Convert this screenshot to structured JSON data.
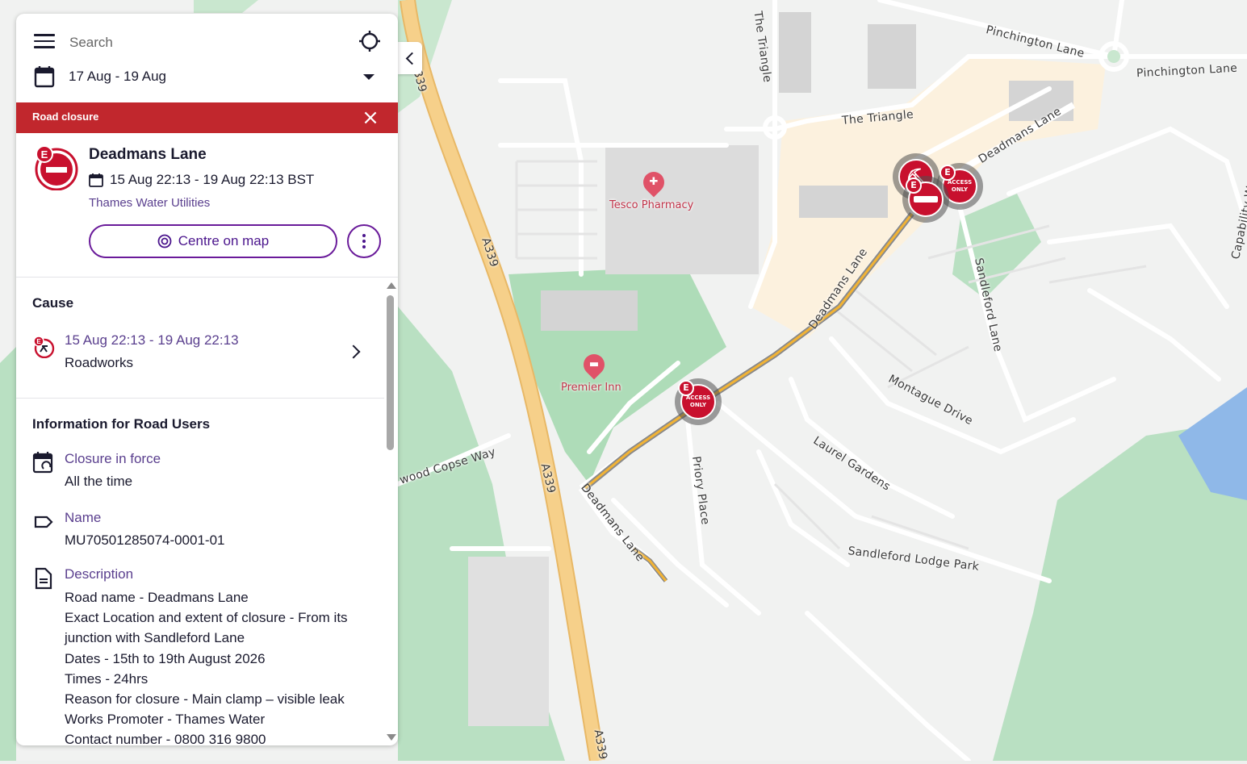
{
  "search": {
    "placeholder": "Search"
  },
  "date_filter": {
    "value": "17 Aug - 19 Aug"
  },
  "closure_bar": {
    "title": "Road closure"
  },
  "event": {
    "road_name": "Deadmans Lane",
    "period": "15 Aug 22:13 - 19 Aug 22:13 BST",
    "organisation": "Thames Water Utilities",
    "centre_button": "Centre on map"
  },
  "cause": {
    "title": "Cause",
    "date": "15 Aug 22:13 - 19 Aug 22:13",
    "type": "Roadworks"
  },
  "info": {
    "title": "Information for Road Users",
    "closure": {
      "label": "Closure in force",
      "value": "All the time"
    },
    "name": {
      "label": "Name",
      "value": "MU70501285074-0001-01"
    },
    "description": {
      "label": "Description",
      "lines": [
        "Road name - Deadmans Lane",
        "Exact Location and extent of closure - From its junction with Sandleford Lane",
        "Dates - 15th to 19th August 2026",
        "Times - 24hrs",
        "Reason for closure - Main clamp – visible leak",
        "Works Promoter - Thames Water",
        "Contact number - 0800 316 9800"
      ]
    }
  },
  "map": {
    "labels": {
      "pinchington1": "Pinchington Lane",
      "pinchington2": "Pinchington Lane",
      "triangle_v": "The Triangle",
      "triangle_h": "The Triangle",
      "deadmans_ne": "Deadmans Lane",
      "deadmans_mid": "Deadmans Lane",
      "deadmans_sw": "Deadmans Lane",
      "sandleford": "Sandleford Lane",
      "montague": "Montague Drive",
      "laurel": "Laurel Gardens",
      "priory": "Priory Place",
      "sandleford_lodge": "Sandleford Lodge Park",
      "copse": "wood Copse Way",
      "a339_1": "A339",
      "a339_2": "A339",
      "a339_3": "A339",
      "a339_4": "A339",
      "capability": "Capability Way"
    },
    "pois": {
      "tesco": "Tesco Pharmacy",
      "premier": "Premier Inn"
    },
    "marker_text": "ACCESS ONLY",
    "marker_badge": "E"
  },
  "colors": {
    "closure_red": "#c1272d",
    "accent_purple": "#6a1b9a",
    "road_yellow": "#f6c977"
  }
}
